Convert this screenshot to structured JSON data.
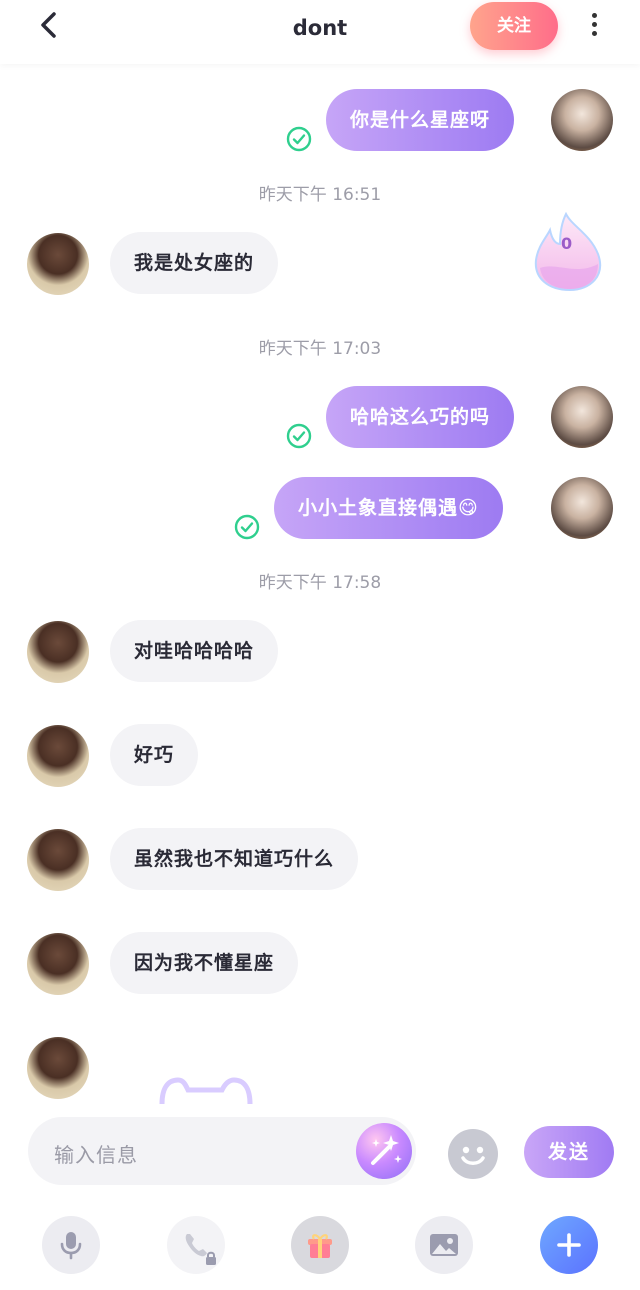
{
  "header": {
    "back_icon": "chevron-left-icon",
    "title": "dont",
    "follow_label": "关注",
    "more_icon": "more-vertical-icon",
    "follow_gradient": [
      "#ffa48c",
      "#ff6d8a"
    ]
  },
  "messages": [
    {
      "from": "me",
      "text": "你是什么星座呀",
      "status": "read-check-icon"
    },
    {
      "type": "time",
      "text": "昨天下午 16:51"
    },
    {
      "from": "them",
      "text": "我是处女座的"
    },
    {
      "type": "time",
      "text": "昨天下午 17:03"
    },
    {
      "from": "me",
      "text": "哈哈这么巧的吗",
      "status": "read-check-icon"
    },
    {
      "from": "me",
      "text": "小小土象直接偶遇😋",
      "status": "read-check-icon"
    },
    {
      "type": "time",
      "text": "昨天下午 17:58"
    },
    {
      "from": "them",
      "text": "对哇哈哈哈哈"
    },
    {
      "from": "them",
      "text": "好巧"
    },
    {
      "from": "them",
      "text": "虽然我也不知道巧什么"
    },
    {
      "from": "them",
      "text": "因为我不懂星座"
    },
    {
      "from": "them",
      "text": ""
    }
  ],
  "intimacy": {
    "value": "0",
    "icon": "flame-icon"
  },
  "input": {
    "placeholder": "输入信息",
    "magic_icon": "magic-wand-icon",
    "emoji_icon": "smiley-icon",
    "send_label": "发送"
  },
  "toolbar": {
    "items": [
      "microphone-icon",
      "phone-locked-icon",
      "gift-icon",
      "image-icon",
      "plus-icon"
    ]
  },
  "colors": {
    "outgoing_bubble": [
      "#c6a5f7",
      "#9d7bf2"
    ],
    "incoming_bubble": "#f3f3f6",
    "check": "#2fcf8e"
  }
}
